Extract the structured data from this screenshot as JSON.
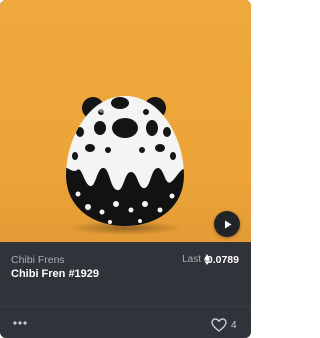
{
  "card": {
    "collection_name": "Chibi Frens",
    "item_name": "Chibi Fren #1929",
    "price_label": "Last",
    "price_value": "0.0789",
    "currency_icon": "ethereum-icon",
    "like_count": "4"
  },
  "colors": {
    "background_orange": "#eea83c",
    "card_dark": "#303339",
    "muted_text": "#a9adb5"
  }
}
